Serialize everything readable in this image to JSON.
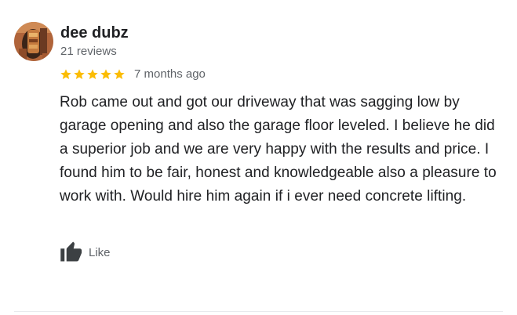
{
  "review": {
    "author_name": "dee dubz",
    "review_count": "21 reviews",
    "rating": 5,
    "rating_max": 5,
    "star_color": "#fbbc04",
    "date": "7 months ago",
    "text": "Rob came out and got our driveway that was sagging low by garage opening and also the garage floor leveled. I believe he did a superior job and we are very happy with the results and price. I found him to be fair, honest and knowledgeable also a pleasure to work with. Would hire him again if i ever need concrete lifting.",
    "like_label": "Like",
    "like_icon": "thumbs-up-icon"
  }
}
